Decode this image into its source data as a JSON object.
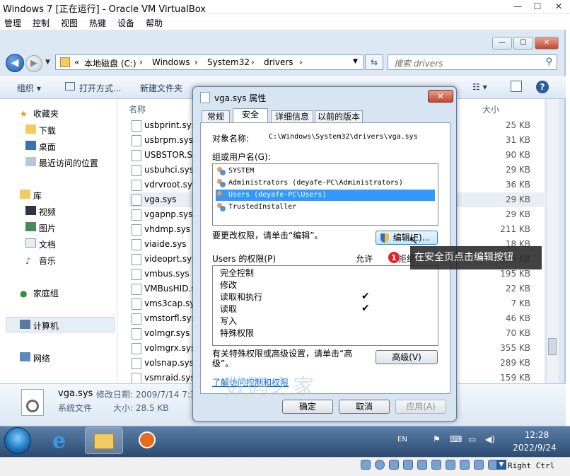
{
  "vbox": {
    "title": "Windows 7 [正在运行] - Oracle VM VirtualBox",
    "menu": [
      "管理",
      "控制",
      "视图",
      "热键",
      "设备",
      "帮助"
    ],
    "host_key": "Right Ctrl"
  },
  "explorer": {
    "address": [
      "«",
      "本地磁盘 (C:)",
      "›",
      "Windows",
      "›",
      "System32",
      "›",
      "drivers",
      "›"
    ],
    "search_placeholder": "搜索 drivers",
    "toolbar": {
      "organize": "组织 ▾",
      "open_with": "打开方式...",
      "new_folder": "新建文件夹"
    },
    "nav": {
      "favorites": "收藏夹",
      "downloads": "下载",
      "desktop": "桌面",
      "recent": "最近访问的位置",
      "libraries": "库",
      "videos": "视频",
      "pictures": "图片",
      "documents": "文档",
      "music": "音乐",
      "homegroup": "家庭组",
      "computer": "计算机",
      "network": "网络"
    },
    "columns": {
      "name": "名称",
      "size": "大小"
    },
    "files": [
      {
        "name": "usbprint.sys",
        "size": "25 KB"
      },
      {
        "name": "usbrpm.sys",
        "size": "31 KB"
      },
      {
        "name": "USBSTOR.SYS",
        "size": "90 KB"
      },
      {
        "name": "usbuhci.sys",
        "size": "29 KB"
      },
      {
        "name": "vdrvroot.sys",
        "size": "36 KB"
      },
      {
        "name": "vga.sys",
        "size": "29 KB"
      },
      {
        "name": "vgapnp.sys",
        "size": "29 KB"
      },
      {
        "name": "vhdmp.sys",
        "size": "211 KB"
      },
      {
        "name": "viaide.sys",
        "size": "18 KB"
      },
      {
        "name": "videoprt.sys",
        "size": "126 KB"
      },
      {
        "name": "vmbus.sys",
        "size": "195 KB"
      },
      {
        "name": "VMBusHID.sys",
        "size": "22 KB"
      },
      {
        "name": "vms3cap.sys",
        "size": "7 KB"
      },
      {
        "name": "vmstorfl.sys",
        "size": "46 KB"
      },
      {
        "name": "volmgr.sys",
        "size": "70 KB"
      },
      {
        "name": "volmgrx.sys",
        "size": "355 KB"
      },
      {
        "name": "volsnap.sys",
        "size": "289 KB"
      },
      {
        "name": "vsmraid.sys",
        "size": "159 KB"
      }
    ],
    "details": {
      "name": "vga.sys",
      "modified_label": "修改日期: 2009/7/14 7:3",
      "type": "系统文件",
      "size_label": "大小: 28.5 KB"
    }
  },
  "dialog": {
    "title": "vga.sys 属性",
    "tabs": [
      "常规",
      "安全",
      "详细信息",
      "以前的版本"
    ],
    "object_label": "对象名称:",
    "object_value": "C:\\Windows\\System32\\drivers\\vga.sys",
    "group_label": "组或用户名(G):",
    "principals": [
      "SYSTEM",
      "Administrators (deyafe-PC\\Administrators)",
      "Users (deyafe-PC\\Users)",
      "TrustedInstaller"
    ],
    "change_hint": "要更改权限，请单击“编辑”。",
    "edit_button": "编辑(E)...",
    "perm_label": "Users 的权限(P)",
    "allow": "允许",
    "deny": "拒绝",
    "permissions": [
      {
        "name": "完全控制",
        "allow": false
      },
      {
        "name": "修改",
        "allow": false
      },
      {
        "name": "读取和执行",
        "allow": true
      },
      {
        "name": "读取",
        "allow": true
      },
      {
        "name": "写入",
        "allow": false
      },
      {
        "name": "特殊权限",
        "allow": false
      }
    ],
    "advanced_hint": "有关特殊权限或高级设置，请单击“高级”。",
    "advanced_button": "高级(V)",
    "link": "了解访问控制和权限",
    "ok": "确定",
    "cancel": "取消",
    "apply": "应用(A)"
  },
  "annotation": {
    "badge": "1",
    "text": "在安全页点击编辑按钮"
  },
  "watermark": "数码之家",
  "taskbar": {
    "lang": "EN",
    "time": "12:28",
    "date": "2022/9/24"
  },
  "colors": {
    "selection": "#3399ff",
    "tooltip_bg": "#282828",
    "badge": "#e0242a"
  }
}
